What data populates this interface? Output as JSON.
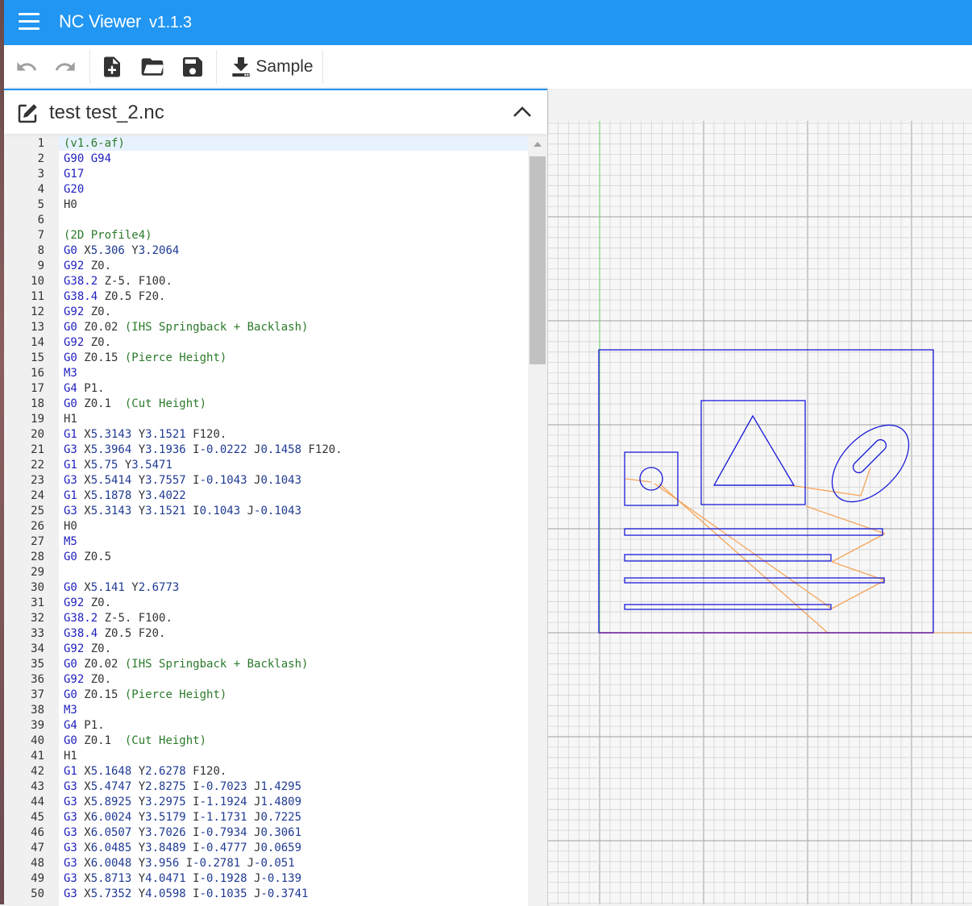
{
  "app": {
    "title": "NC Viewer",
    "version": "v1.1.3"
  },
  "toolbar": {
    "sample_label": "Sample"
  },
  "editor": {
    "file_name": "test test_2.nc",
    "lines": [
      {
        "n": "1",
        "t": "(v1.6-af)"
      },
      {
        "n": "2",
        "t": "G90 G94"
      },
      {
        "n": "3",
        "t": "G17"
      },
      {
        "n": "4",
        "t": "G20"
      },
      {
        "n": "5",
        "t": "H0"
      },
      {
        "n": "6",
        "t": ""
      },
      {
        "n": "7",
        "t": "(2D Profile4)"
      },
      {
        "n": "8",
        "t": "G0 X5.306 Y3.2064"
      },
      {
        "n": "9",
        "t": "G92 Z0."
      },
      {
        "n": "10",
        "t": "G38.2 Z-5. F100."
      },
      {
        "n": "11",
        "t": "G38.4 Z0.5 F20."
      },
      {
        "n": "12",
        "t": "G92 Z0."
      },
      {
        "n": "13",
        "t": "G0 Z0.02 (IHS Springback + Backlash)"
      },
      {
        "n": "14",
        "t": "G92 Z0."
      },
      {
        "n": "15",
        "t": "G0 Z0.15 (Pierce Height)"
      },
      {
        "n": "16",
        "t": "M3"
      },
      {
        "n": "17",
        "t": "G4 P1."
      },
      {
        "n": "18",
        "t": "G0 Z0.1  (Cut Height)"
      },
      {
        "n": "19",
        "t": "H1"
      },
      {
        "n": "20",
        "t": "G1 X5.3143 Y3.1521 F120."
      },
      {
        "n": "21",
        "t": "G3 X5.3964 Y3.1936 I-0.0222 J0.1458 F120."
      },
      {
        "n": "22",
        "t": "G1 X5.75 Y3.5471"
      },
      {
        "n": "23",
        "t": "G3 X5.5414 Y3.7557 I-0.1043 J0.1043"
      },
      {
        "n": "24",
        "t": "G1 X5.1878 Y3.4022"
      },
      {
        "n": "25",
        "t": "G3 X5.3143 Y3.1521 I0.1043 J-0.1043"
      },
      {
        "n": "26",
        "t": "H0"
      },
      {
        "n": "27",
        "t": "M5"
      },
      {
        "n": "28",
        "t": "G0 Z0.5"
      },
      {
        "n": "29",
        "t": ""
      },
      {
        "n": "30",
        "t": "G0 X5.141 Y2.6773"
      },
      {
        "n": "31",
        "t": "G92 Z0."
      },
      {
        "n": "32",
        "t": "G38.2 Z-5. F100."
      },
      {
        "n": "33",
        "t": "G38.4 Z0.5 F20."
      },
      {
        "n": "34",
        "t": "G92 Z0."
      },
      {
        "n": "35",
        "t": "G0 Z0.02 (IHS Springback + Backlash)"
      },
      {
        "n": "36",
        "t": "G92 Z0."
      },
      {
        "n": "37",
        "t": "G0 Z0.15 (Pierce Height)"
      },
      {
        "n": "38",
        "t": "M3"
      },
      {
        "n": "39",
        "t": "G4 P1."
      },
      {
        "n": "40",
        "t": "G0 Z0.1  (Cut Height)"
      },
      {
        "n": "41",
        "t": "H1"
      },
      {
        "n": "42",
        "t": "G1 X5.1648 Y2.6278 F120."
      },
      {
        "n": "43",
        "t": "G3 X5.4747 Y2.8275 I-0.7023 J1.4295"
      },
      {
        "n": "44",
        "t": "G3 X5.8925 Y3.2975 I-1.1924 J1.4809"
      },
      {
        "n": "45",
        "t": "G3 X6.0024 Y3.5179 I-1.1731 J0.7225"
      },
      {
        "n": "46",
        "t": "G3 X6.0507 Y3.7026 I-0.7934 J0.3061"
      },
      {
        "n": "47",
        "t": "G3 X6.0485 Y3.8489 I-0.4777 J0.0659"
      },
      {
        "n": "48",
        "t": "G3 X6.0048 Y3.956 I-0.2781 J-0.051"
      },
      {
        "n": "49",
        "t": "G3 X5.8713 Y4.0471 I-0.1928 J-0.139"
      },
      {
        "n": "50",
        "t": "G3 X5.7352 Y4.0598 I-0.1035 J-0.3741"
      }
    ]
  },
  "viewer": {
    "colors": {
      "cut": "#1a1adb",
      "rapid": "#f5a65b",
      "axis_y": "#6fd66f",
      "grid_minor": "#d4d4d4",
      "grid_major": "#b0b0b0"
    }
  }
}
